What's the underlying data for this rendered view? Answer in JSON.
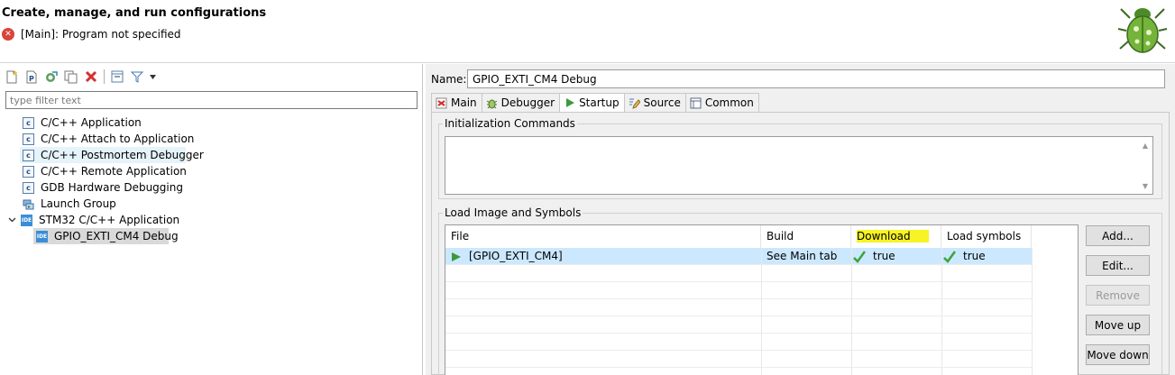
{
  "header": {
    "title": "Create, manage, and run configurations",
    "error_message": "[Main]: Program not specified",
    "logo_icon": "bug-icon"
  },
  "toolbar": {
    "buttons": [
      "new-config-icon",
      "new-prototype-icon",
      "export-icon",
      "duplicate-icon",
      "delete-icon",
      "collapse-all-icon",
      "filter-icon",
      "dropdown-arrow-icon"
    ]
  },
  "filter": {
    "placeholder": "type filter text",
    "value": ""
  },
  "tree": {
    "items": [
      {
        "label": "C/C++ Application",
        "icon": "c-launch-icon"
      },
      {
        "label": "C/C++ Attach to Application",
        "icon": "c-launch-icon"
      },
      {
        "label": "C/C++ Postmortem Debugger",
        "icon": "c-launch-icon"
      },
      {
        "label": "C/C++ Remote Application",
        "icon": "c-launch-icon"
      },
      {
        "label": "GDB Hardware Debugging",
        "icon": "c-launch-icon"
      },
      {
        "label": "Launch Group",
        "icon": "launch-group-icon"
      },
      {
        "label": "STM32 C/C++ Application",
        "icon": "ide-icon",
        "expanded": true
      },
      {
        "label": "GPIO_EXTI_CM4 Debug",
        "icon": "ide-icon",
        "selected": true
      }
    ]
  },
  "config": {
    "name_label": "Name:",
    "name_value": "GPIO_EXTI_CM4 Debug",
    "tabs": [
      {
        "label": "Main",
        "icon": "main-tab-icon"
      },
      {
        "label": "Debugger",
        "icon": "debugger-tab-icon"
      },
      {
        "label": "Startup",
        "icon": "startup-tab-icon",
        "active": true
      },
      {
        "label": "Source",
        "icon": "source-tab-icon"
      },
      {
        "label": "Common",
        "icon": "common-tab-icon"
      }
    ],
    "init_commands_label": "Initialization Commands",
    "init_commands_value": "",
    "load_group_label": "Load Image and Symbols",
    "table": {
      "columns": [
        "File",
        "Build",
        "Download",
        "Load symbols"
      ],
      "rows": [
        {
          "file": "[GPIO_EXTI_CM4]",
          "build": "See Main tab",
          "download": "true",
          "load_symbols": "true"
        }
      ]
    },
    "buttons": {
      "add": "Add...",
      "edit": "Edit...",
      "remove": "Remove",
      "move_up": "Move up",
      "move_down": "Move down"
    },
    "highlight_color": "#f7f324"
  }
}
